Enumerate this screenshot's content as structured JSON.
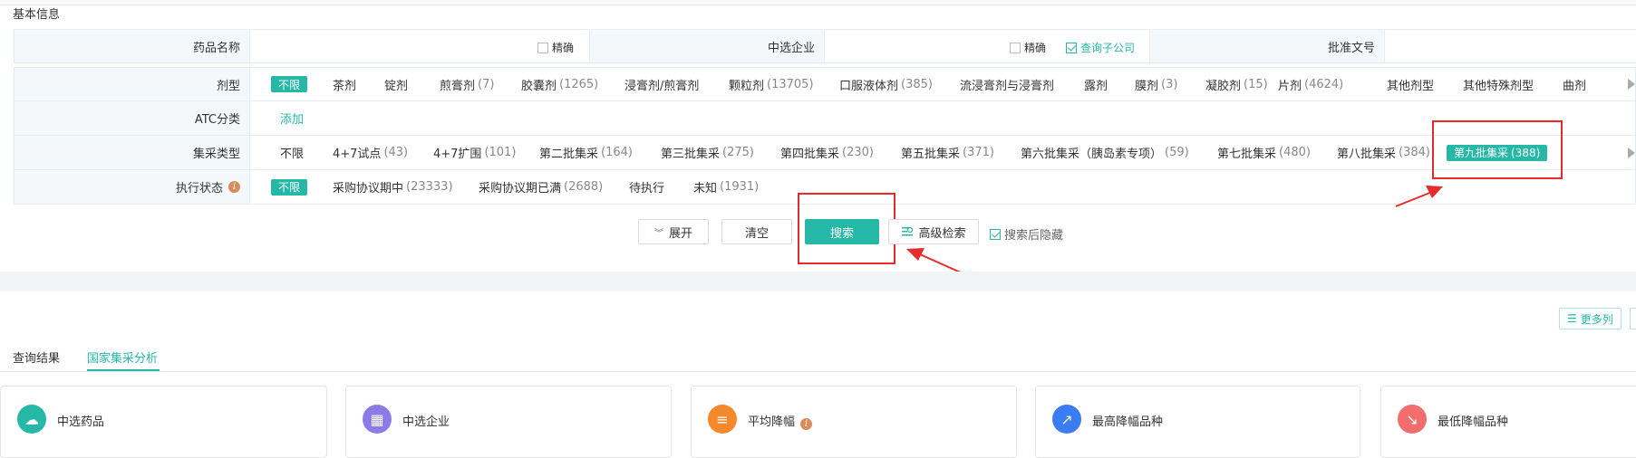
{
  "section": {
    "title": "基本信息"
  },
  "basic": {
    "drug_name_label": "药品名称",
    "exact1_label": "精确",
    "company_label": "中选企业",
    "exact2_label": "精确",
    "subsidiary_label": "查询子公司",
    "approval_label": "批准文号"
  },
  "dosage": {
    "label": "剂型",
    "options": [
      {
        "name": "不限",
        "count": ""
      },
      {
        "name": "茶剂",
        "count": ""
      },
      {
        "name": "锭剂",
        "count": ""
      },
      {
        "name": "煎膏剂",
        "count": "(7)"
      },
      {
        "name": "胶囊剂",
        "count": "(1265)"
      },
      {
        "name": "浸膏剂/煎膏剂",
        "count": ""
      },
      {
        "name": "颗粒剂",
        "count": "(13705)"
      },
      {
        "name": "口服液体剂",
        "count": "(385)"
      },
      {
        "name": "流浸膏剂与浸膏剂",
        "count": ""
      },
      {
        "name": "露剂",
        "count": ""
      },
      {
        "name": "膜剂",
        "count": "(3)"
      },
      {
        "name": "凝胶剂",
        "count": "(15)"
      },
      {
        "name": "片剂",
        "count": "(4624)"
      },
      {
        "name": "其他剂型",
        "count": ""
      },
      {
        "name": "其他特殊剂型",
        "count": ""
      },
      {
        "name": "曲剂",
        "count": ""
      }
    ]
  },
  "atc": {
    "label": "ATC分类",
    "add": "添加"
  },
  "procurement": {
    "label": "集采类型",
    "options": [
      {
        "name": "不限",
        "count": ""
      },
      {
        "name": "4+7试点",
        "count": "(43)"
      },
      {
        "name": "4+7扩围",
        "count": "(101)"
      },
      {
        "name": "第二批集采",
        "count": "(164)"
      },
      {
        "name": "第三批集采",
        "count": "(275)"
      },
      {
        "name": "第四批集采",
        "count": "(230)"
      },
      {
        "name": "第五批集采",
        "count": "(371)"
      },
      {
        "name": "第六批集采（胰岛素专项）",
        "count": "(59)"
      },
      {
        "name": "第七批集采",
        "count": "(480)"
      },
      {
        "name": "第八批集采",
        "count": "(384)"
      },
      {
        "name": "第九批集采",
        "count": "(388)"
      }
    ]
  },
  "status": {
    "label": "执行状态",
    "options": [
      {
        "name": "不限",
        "count": ""
      },
      {
        "name": "采购协议期中",
        "count": "(23333)"
      },
      {
        "name": "采购协议期已满",
        "count": "(2688)"
      },
      {
        "name": "待执行",
        "count": ""
      },
      {
        "name": "未知",
        "count": "(1931)"
      }
    ]
  },
  "actions": {
    "expand": "展开",
    "clear": "清空",
    "search": "搜索",
    "advanced": "高级检索",
    "hide_after": "搜索后隐藏",
    "more_columns": "更多列"
  },
  "tabs": [
    "查询结果",
    "国家集采分析"
  ],
  "cards": [
    {
      "label": "中选药品",
      "color": "#26b8a7",
      "icon": "pill-cloud-icon"
    },
    {
      "label": "中选企业",
      "color": "#8b7be8",
      "icon": "building-icon"
    },
    {
      "label": "平均降幅",
      "color": "#f5882a",
      "icon": "sort-down-icon"
    },
    {
      "label": "最高降幅品种",
      "color": "#3b7cf0",
      "icon": "arrow-up-right-icon"
    },
    {
      "label": "最低降幅品种",
      "color": "#f26d6d",
      "icon": "arrow-down-right-icon"
    }
  ],
  "colors": {
    "accent": "#26b8a7",
    "highlight": "#e52b2b"
  }
}
